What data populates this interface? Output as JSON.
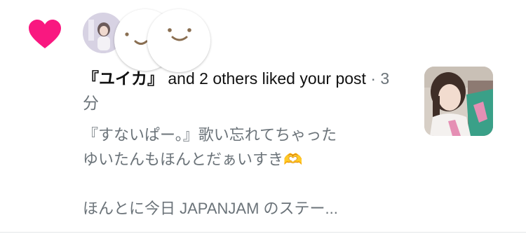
{
  "notification": {
    "actor_name": "『ユイカ』",
    "title_rest": " and 2 others liked your post",
    "separator": " · ",
    "time": "3分",
    "snippet_lines": [
      "『すないぱー。』歌い忘れてちゃった",
      "ゆいたんもほんとだぁいすき🫶",
      "ほんとに今日 JAPANJAM のステー..."
    ]
  },
  "colors": {
    "heart": "#f91880",
    "text_primary": "#111111",
    "text_secondary": "#6b7379",
    "face_features": "#8a6f52"
  },
  "icons": [
    "heart-icon",
    "smile-face-icon"
  ]
}
